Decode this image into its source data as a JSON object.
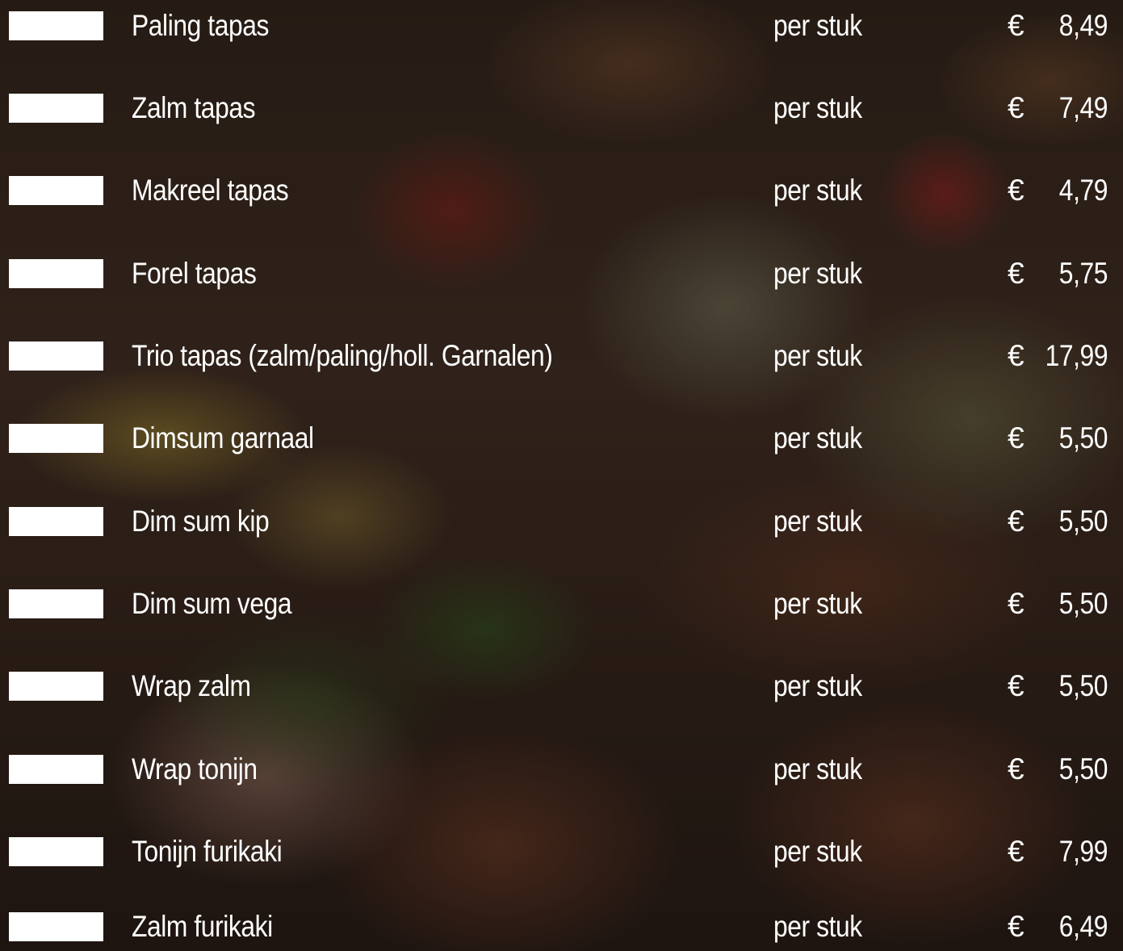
{
  "menu": {
    "items": [
      {
        "name": "Paling tapas",
        "unit": "per stuk",
        "currency": "€",
        "price": "8,49"
      },
      {
        "name": "Zalm tapas",
        "unit": "per stuk",
        "currency": "€",
        "price": "7,49"
      },
      {
        "name": "Makreel tapas",
        "unit": "per stuk",
        "currency": "€",
        "price": "4,79"
      },
      {
        "name": "Forel tapas",
        "unit": "per stuk",
        "currency": "€",
        "price": "5,75"
      },
      {
        "name": "Trio tapas (zalm/paling/holl. Garnalen)",
        "unit": "per stuk",
        "currency": "€",
        "price": "17,99"
      },
      {
        "name": "Dimsum garnaal",
        "unit": "per stuk",
        "currency": "€",
        "price": "5,50"
      },
      {
        "name": "Dim sum kip",
        "unit": "per stuk",
        "currency": "€",
        "price": "5,50"
      },
      {
        "name": "Dim sum vega",
        "unit": "per stuk",
        "currency": "€",
        "price": "5,50"
      },
      {
        "name": "Wrap zalm",
        "unit": "per stuk",
        "currency": "€",
        "price": "5,50"
      },
      {
        "name": "Wrap tonijn",
        "unit": "per stuk",
        "currency": "€",
        "price": "5,50"
      },
      {
        "name": "Tonijn furikaki",
        "unit": "per stuk",
        "currency": "€",
        "price": "7,99"
      },
      {
        "name": "Zalm furikaki",
        "unit": "per stuk",
        "currency": "€",
        "price": "6,49"
      }
    ]
  }
}
